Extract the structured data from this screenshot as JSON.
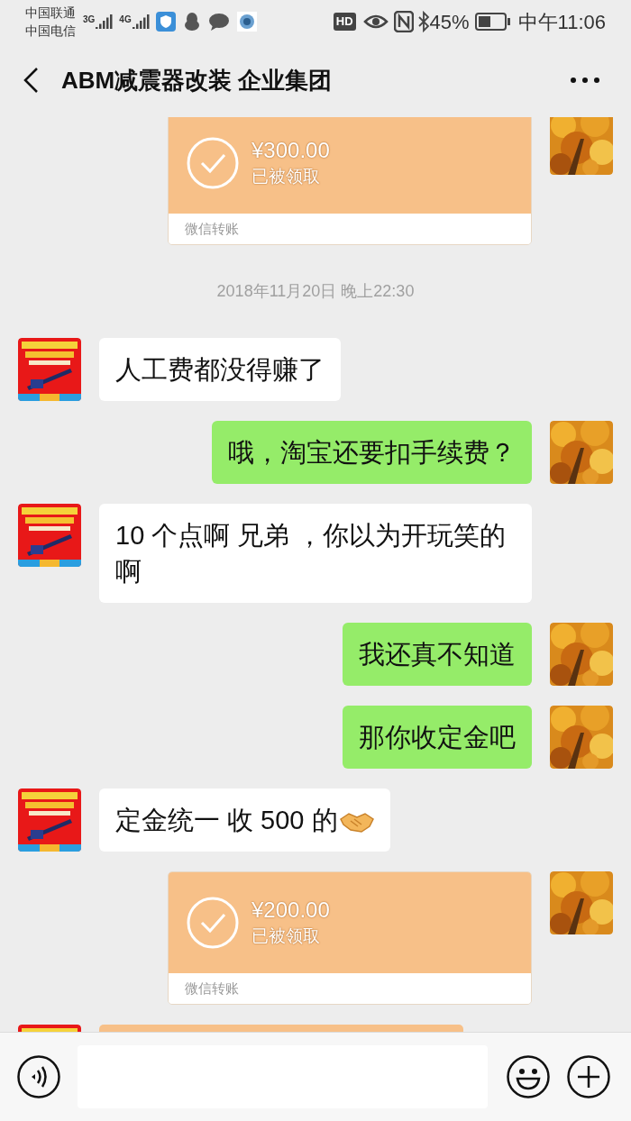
{
  "status_bar": {
    "carriers": [
      "中国联通",
      "中国电信"
    ],
    "networks": [
      "3G",
      "4G"
    ],
    "hd_badge": "HD",
    "battery": "45%",
    "time": "中午11:06"
  },
  "header": {
    "title": "ABM减震器改装 企业集团"
  },
  "messages": [
    {
      "kind": "transfer",
      "outgoing": true,
      "amount": "¥300.00",
      "status": "已被领取",
      "footer": "微信转账"
    },
    {
      "kind": "time",
      "text": "2018年11月20日 晚上22:30"
    },
    {
      "kind": "text",
      "outgoing": false,
      "text": "人工费都没得赚了"
    },
    {
      "kind": "text",
      "outgoing": true,
      "text": "哦，淘宝还要扣手续费？"
    },
    {
      "kind": "text",
      "outgoing": false,
      "text": "10 个点啊 兄弟 ，你以为开玩笑的啊"
    },
    {
      "kind": "text",
      "outgoing": true,
      "text": "我还真不知道"
    },
    {
      "kind": "text",
      "outgoing": true,
      "text": "那你收定金吧"
    },
    {
      "kind": "text",
      "outgoing": false,
      "text": "定金统一 收 500 的",
      "handshake_emoji": true
    },
    {
      "kind": "transfer",
      "outgoing": true,
      "amount": "¥200.00",
      "status": "已被领取",
      "footer": "微信转账"
    },
    {
      "kind": "transfer",
      "outgoing": false
    }
  ]
}
